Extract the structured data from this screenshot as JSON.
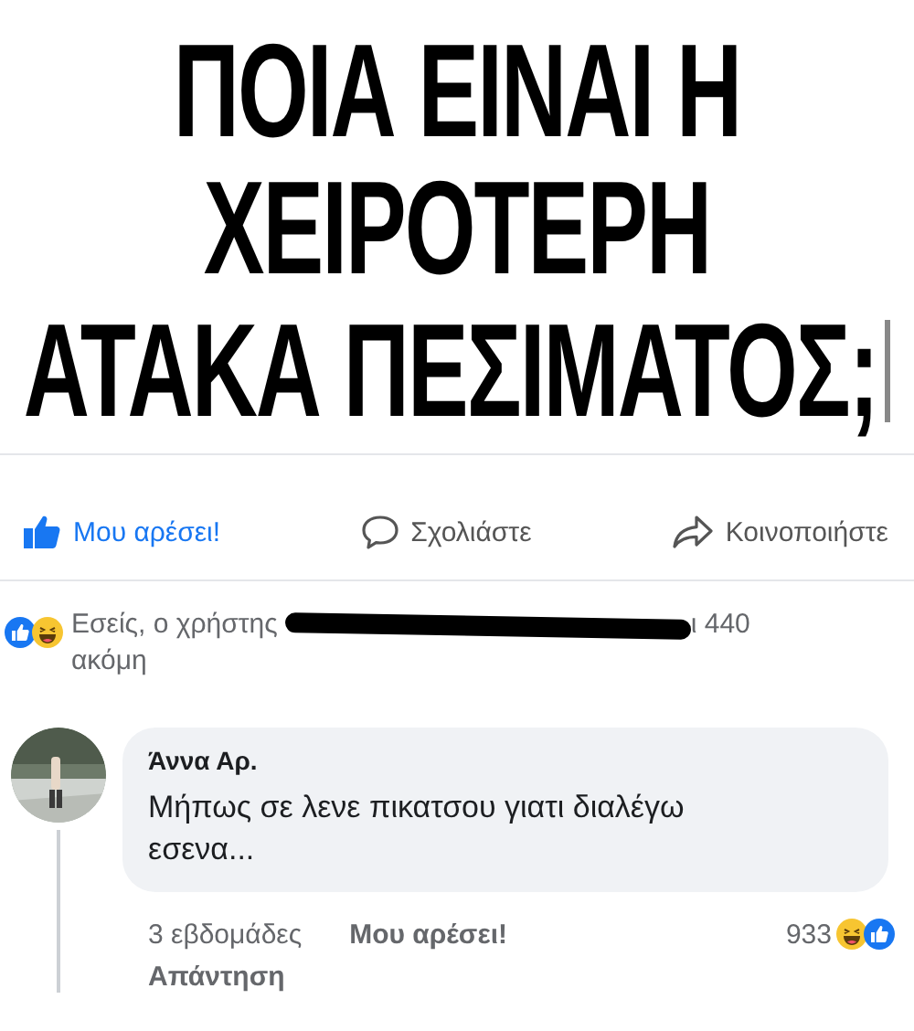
{
  "post": {
    "title_lines": [
      "ΠΟΙΑ ΕΙΝΑΙ Η",
      "ΧΕΙΡΟΤΕΡΗ",
      "ΑΤΑΚΑ ΠΕΣΙΜΑΤΟΣ;"
    ]
  },
  "actions": [
    {
      "kind": "like",
      "label": "Μου αρέσει!"
    },
    {
      "kind": "comment",
      "label": "Σχολιάστε"
    },
    {
      "kind": "share",
      "label": "Κοινοποιήστε"
    }
  ],
  "reactions_summary": {
    "text_before": "Εσείς, ο χρήστης",
    "text_after": "ι 440",
    "second_line": "ακόμη"
  },
  "comment": {
    "author": "Άννα Αρ.",
    "text": "Μήπως σε λενε πικατσου γιατι διαλέγω εσενα...",
    "time": "3 εβδομάδες",
    "like_label": "Μου αρέσει!",
    "reaction_count": "933",
    "reply_label": "Απάντηση"
  }
}
